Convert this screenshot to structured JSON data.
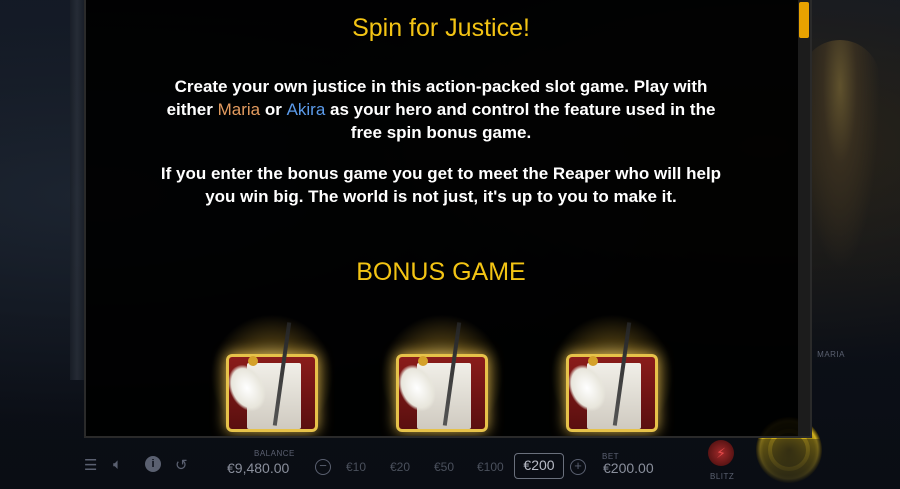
{
  "info_panel": {
    "title": "Spin for Justice!",
    "intro": {
      "before_maria": "Create your own justice in this action-packed slot game. Play with either ",
      "maria": "Maria",
      "between": " or ",
      "akira": "Akira",
      "after_akira": " as your hero and control the feature used in the free spin bonus game."
    },
    "reaper_text": "If you enter the bonus game you get to meet the Reaper who will help you win big. The world is not just, it's up to you to make it.",
    "bonus_title": "BONUS GAME",
    "bonus_symbols": [
      "bonus-scroll-symbol",
      "bonus-scroll-symbol",
      "bonus-scroll-symbol"
    ]
  },
  "background": {
    "hero_label": "MARIA"
  },
  "controls": {
    "balance_label": "BALANCE",
    "balance_value": "€9,480.00",
    "bet_label": "BET",
    "bet_value": "€200.00",
    "minus": "−",
    "plus": "+",
    "chips": [
      "€10",
      "€20",
      "€50",
      "€100"
    ],
    "selected_chip": "€200",
    "blitz_label": "BLITZ",
    "icons": [
      "menu-icon",
      "sound-icon",
      "info-icon",
      "history-icon"
    ]
  },
  "colors": {
    "title": "#f3c414",
    "maria": "#e39b5f",
    "akira": "#5b9bea",
    "scroll_thumb": "#e8a200"
  }
}
